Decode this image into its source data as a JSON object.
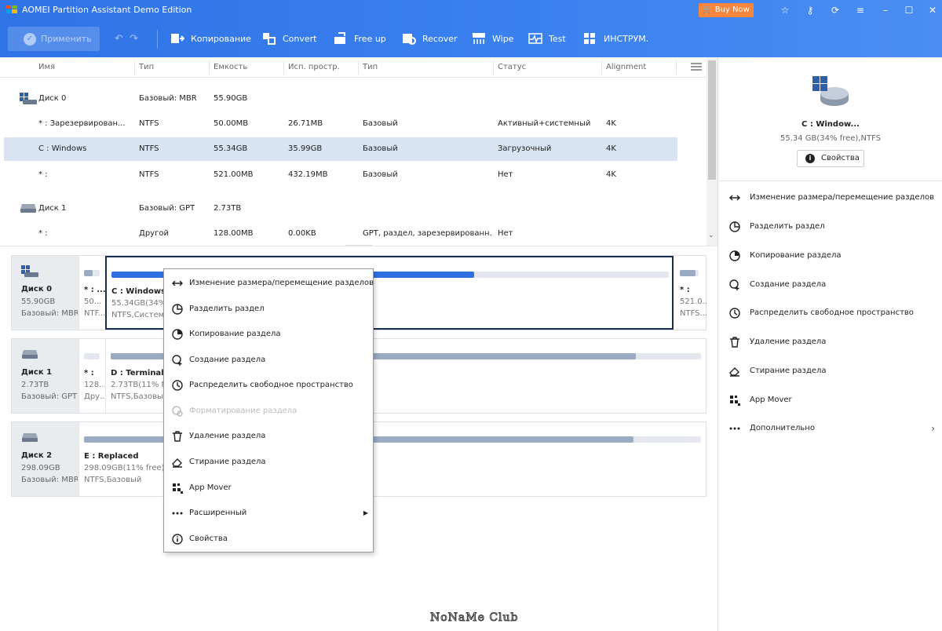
{
  "app": {
    "title": "AOMEI Partition Assistant Demo Edition",
    "buy_label": "Buy Now"
  },
  "toolbar": {
    "apply_label": "Применить",
    "items": [
      {
        "label": "Копирование",
        "icon": "copy-icon"
      },
      {
        "label": "Convert",
        "icon": "convert-icon"
      },
      {
        "label": "Free up",
        "icon": "free-up-icon"
      },
      {
        "label": "Recover",
        "icon": "recover-icon"
      },
      {
        "label": "Wipe",
        "icon": "wipe-icon"
      },
      {
        "label": "Test",
        "icon": "test-icon"
      },
      {
        "label": "ИНСТРУМ.",
        "icon": "tools-icon"
      }
    ]
  },
  "table": {
    "headers": [
      "Имя",
      "Тип",
      "Емкость",
      "Исп. простр.",
      "Тип",
      "Статус",
      "Alignment"
    ],
    "rows": [
      {
        "kind": "disk",
        "name": "Диск 0",
        "type": "Базовый: MBR",
        "capacity": "55.90GB",
        "used": "",
        "ptype": "",
        "status": "",
        "align": ""
      },
      {
        "kind": "part",
        "name": "* : Зарезервирован...",
        "type": "NTFS",
        "capacity": "50.00MB",
        "used": "26.71MB",
        "ptype": "Базовый",
        "status": "Активный+системный",
        "align": "4K"
      },
      {
        "kind": "part",
        "name": "C : Windows",
        "type": "NTFS",
        "capacity": "55.34GB",
        "used": "35.99GB",
        "ptype": "Базовый",
        "status": "Загрузочный",
        "align": "4K",
        "selected": true
      },
      {
        "kind": "part",
        "name": "* :",
        "type": "NTFS",
        "capacity": "521.00MB",
        "used": "432.19MB",
        "ptype": "Базовый",
        "status": "Нет",
        "align": "4K"
      },
      {
        "kind": "disk",
        "name": "Диск 1",
        "type": "Базовый: GPT",
        "capacity": "2.73TB",
        "used": "",
        "ptype": "",
        "status": "",
        "align": ""
      },
      {
        "kind": "part",
        "name": "* :",
        "type": "Другой",
        "capacity": "128.00MB",
        "used": "0.00KB",
        "ptype": "GPT, раздел, зарезервированн...",
        "status": "Нет",
        "align": ""
      }
    ]
  },
  "disks": [
    {
      "name": "Диск 0",
      "size": "55.90GB",
      "type": "Базовый: MBR",
      "partitions": [
        {
          "name": "* : ...",
          "size": "50...",
          "fs": "NTF...",
          "used_pct": 55
        },
        {
          "name": "C : Windows",
          "size": "55.34GB(34% free)",
          "fs": "NTFS,Системный,Первичный",
          "used_pct": 65,
          "selected": true
        },
        {
          "name": "* :",
          "size": "521.0...",
          "fs": "NTFS...",
          "used_pct": 83
        }
      ]
    },
    {
      "name": "Диск 1",
      "size": "2.73TB",
      "type": "Базовый: GPT",
      "partitions": [
        {
          "name": "* :",
          "size": "128...",
          "fs": "Дру...",
          "used_pct": 0
        },
        {
          "name": "D : Terminal",
          "size": "2.73TB(11% free)",
          "fs": "NTFS,Базовый",
          "used_pct": 89
        }
      ]
    },
    {
      "name": "Диск 2",
      "size": "298.09GB",
      "type": "Базовый: MBR",
      "partitions": [
        {
          "name": "E : Replaced",
          "size": "298.09GB(11% free)",
          "fs": "NTFS,Базовый",
          "used_pct": 89
        }
      ]
    }
  ],
  "right_panel": {
    "name": "C : Window...",
    "sub": "55.34 GB(34% free),NTFS",
    "props_label": "Свойства",
    "items": [
      {
        "label": "Изменение размера/перемещение разделов",
        "icon": "resize-icon"
      },
      {
        "label": "Разделить раздел",
        "icon": "split-icon"
      },
      {
        "label": "Копирование раздела",
        "icon": "copy-partition-icon"
      },
      {
        "label": "Создание раздела",
        "icon": "create-partition-icon"
      },
      {
        "label": "Распределить свободное пространство",
        "icon": "allocate-icon"
      },
      {
        "label": "Удаление раздела",
        "icon": "trash-icon"
      },
      {
        "label": "Стирание раздела",
        "icon": "eraser-icon"
      },
      {
        "label": "App Mover",
        "icon": "app-mover-icon"
      },
      {
        "label": "Дополнительно",
        "icon": "more-icon",
        "submenu": true
      }
    ]
  },
  "context_menu": {
    "items": [
      {
        "label": "Изменение размера/перемещение разделов",
        "icon": "resize-icon"
      },
      {
        "label": "Разделить раздел",
        "icon": "split-icon"
      },
      {
        "label": "Копирование раздела",
        "icon": "copy-partition-icon"
      },
      {
        "label": "Создание раздела",
        "icon": "create-partition-icon"
      },
      {
        "label": "Распределить свободное пространство",
        "icon": "allocate-icon"
      },
      {
        "label": "Форматирование раздела",
        "icon": "format-icon",
        "disabled": true
      },
      {
        "label": "Удаление раздела",
        "icon": "trash-icon"
      },
      {
        "label": "Стирание раздела",
        "icon": "eraser-icon"
      },
      {
        "label": "App Mover",
        "icon": "app-mover-icon"
      },
      {
        "label": "Расширенный",
        "icon": "more-icon",
        "submenu": true
      },
      {
        "label": "Свойства",
        "icon": "info-icon"
      }
    ]
  },
  "watermark": "NoNaMe Club",
  "colors": {
    "accent": "#3b82f0",
    "buy": "#f5863b",
    "selected_row": "#d8e4f2",
    "bar_selected": "#2f6fe0",
    "bar_normal": "#9aabc3"
  }
}
